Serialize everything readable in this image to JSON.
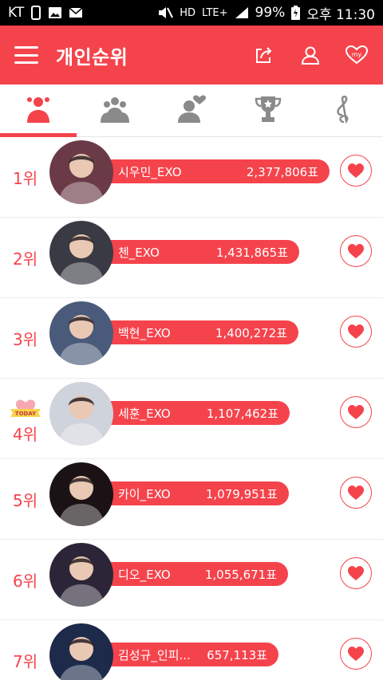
{
  "status_bar": {
    "carrier": "KT",
    "battery": "99%",
    "time": "오후 11:30",
    "hd_label": "HD",
    "network_label": "LTE+"
  },
  "header": {
    "title": "개인순위",
    "menu_icon": "hamburger-menu-icon",
    "actions": [
      "share-icon",
      "profile-icon",
      "my-heart-icon"
    ],
    "my_label": "my"
  },
  "tabs": [
    {
      "icon": "group-ranking-icon",
      "active": true
    },
    {
      "icon": "crowd-ranking-icon",
      "active": false
    },
    {
      "icon": "person-heart-icon",
      "active": false
    },
    {
      "icon": "trophy-icon",
      "active": false
    },
    {
      "icon": "music-note-icon",
      "active": false
    }
  ],
  "colors": {
    "accent": "#f5434c",
    "avatar_tones": [
      "#6a3b46",
      "#3a3a44",
      "#4a5a7a",
      "#cfd3dc",
      "#1a1214",
      "#2c2538",
      "#1d2a4a"
    ]
  },
  "ranking": [
    {
      "rank": "1위",
      "name": "시우민_EXO",
      "votes": "2,377,806표",
      "vote_count": 2377806,
      "today": false
    },
    {
      "rank": "2위",
      "name": "첸_EXO",
      "votes": "1,431,865표",
      "vote_count": 1431865,
      "today": false
    },
    {
      "rank": "3위",
      "name": "백현_EXO",
      "votes": "1,400,272표",
      "vote_count": 1400272,
      "today": false
    },
    {
      "rank": "4위",
      "name": "세훈_EXO",
      "votes": "1,107,462표",
      "vote_count": 1107462,
      "today": true,
      "badge_text": "TODAY"
    },
    {
      "rank": "5위",
      "name": "카이_EXO",
      "votes": "1,079,951표",
      "vote_count": 1079951,
      "today": false
    },
    {
      "rank": "6위",
      "name": "디오_EXO",
      "votes": "1,055,671표",
      "vote_count": 1055671,
      "today": false
    },
    {
      "rank": "7위",
      "name": "김성규_인피...",
      "votes": "657,113표",
      "vote_count": 657113,
      "today": false
    }
  ]
}
